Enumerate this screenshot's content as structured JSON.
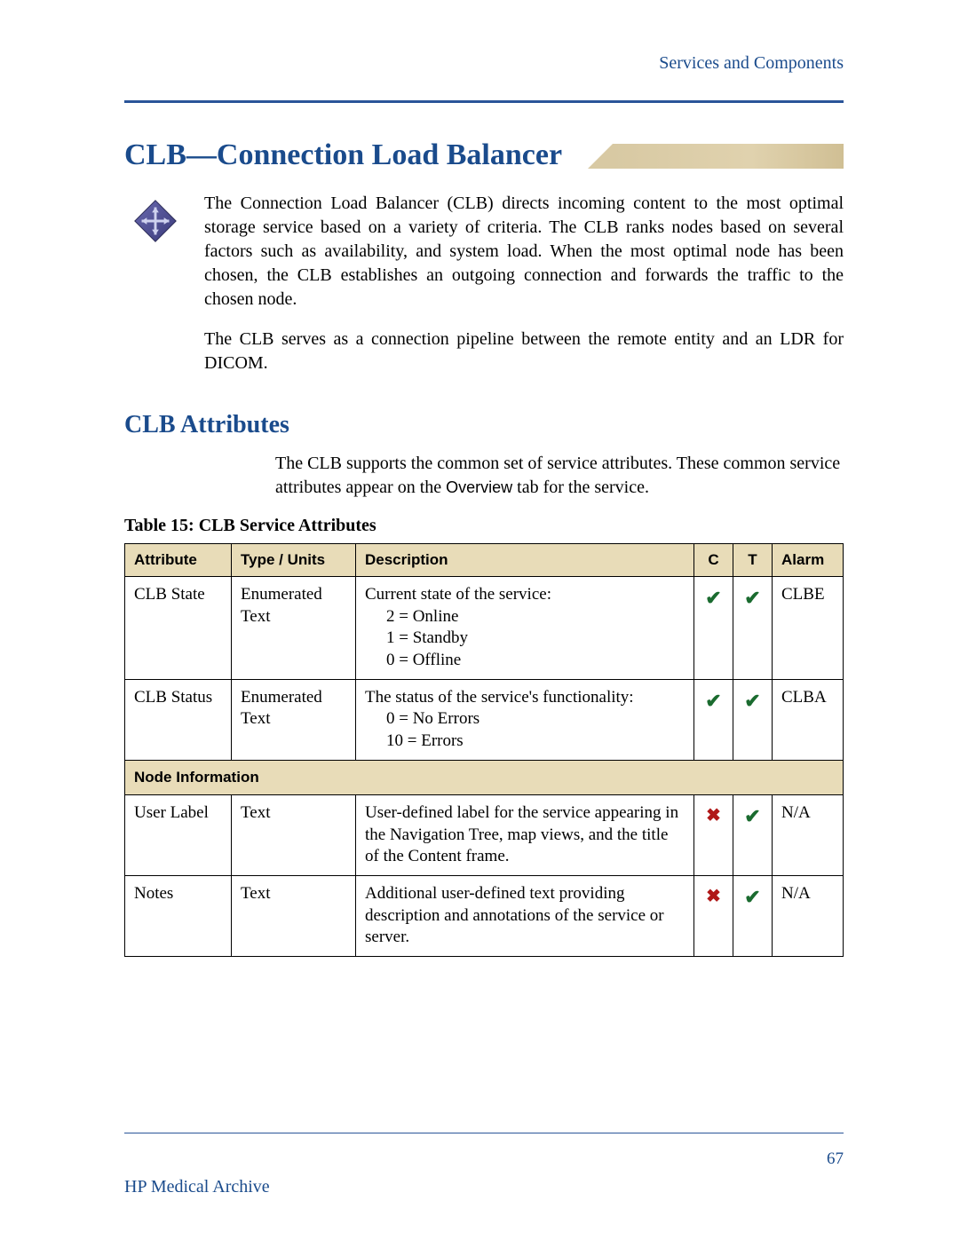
{
  "header": {
    "breadcrumb": "Services and Components"
  },
  "title": "CLB—Connection Load Balancer",
  "intro": {
    "p1": "The Connection Load Balancer (CLB) directs incoming content to the most optimal storage service based on a variety of criteria. The CLB ranks nodes based on several factors such as availability, and system load. When the most optimal node has been chosen, the CLB establishes an outgoing connection and forwards the traffic to the chosen node.",
    "p2": "The CLB serves as a connection pipeline between the remote entity and an LDR for DICOM."
  },
  "subhead": "CLB Attributes",
  "subpara_prefix": "The CLB supports the common set of service attributes. These common service attributes appear on the ",
  "subpara_overview": "Overview",
  "subpara_suffix": " tab for the service.",
  "table": {
    "caption": "Table 15: CLB Service Attributes",
    "headers": {
      "attribute": "Attribute",
      "type": "Type / Units",
      "description": "Description",
      "c": "C",
      "t": "T",
      "alarm": "Alarm"
    },
    "rows": [
      {
        "attribute": "CLB State",
        "type": "Enumerated Text",
        "desc_main": "Current state of the service:",
        "desc_lines": [
          "2 = Online",
          "1 = Standby",
          "0 = Offline"
        ],
        "c": true,
        "t": true,
        "alarm": "CLBE"
      },
      {
        "attribute": "CLB Status",
        "type": "Enumerated Text",
        "desc_main": "The status of the service's functionality:",
        "desc_lines": [
          "0 = No Errors",
          "10 = Errors"
        ],
        "c": true,
        "t": true,
        "alarm": "CLBA"
      }
    ],
    "section": "Node Information",
    "rows2": [
      {
        "attribute": "User Label",
        "type": "Text",
        "desc_main": "User-defined label for the service appearing in the Navigation Tree, map views, and the title of the Content frame.",
        "desc_lines": [],
        "c": false,
        "t": true,
        "alarm": "N/A"
      },
      {
        "attribute": "Notes",
        "type": "Text",
        "desc_main": "Additional user-defined text providing description and annotations of the service or server.",
        "desc_lines": [],
        "c": false,
        "t": true,
        "alarm": "N/A"
      }
    ]
  },
  "footer": {
    "left": "HP Medical Archive",
    "page": "67"
  }
}
